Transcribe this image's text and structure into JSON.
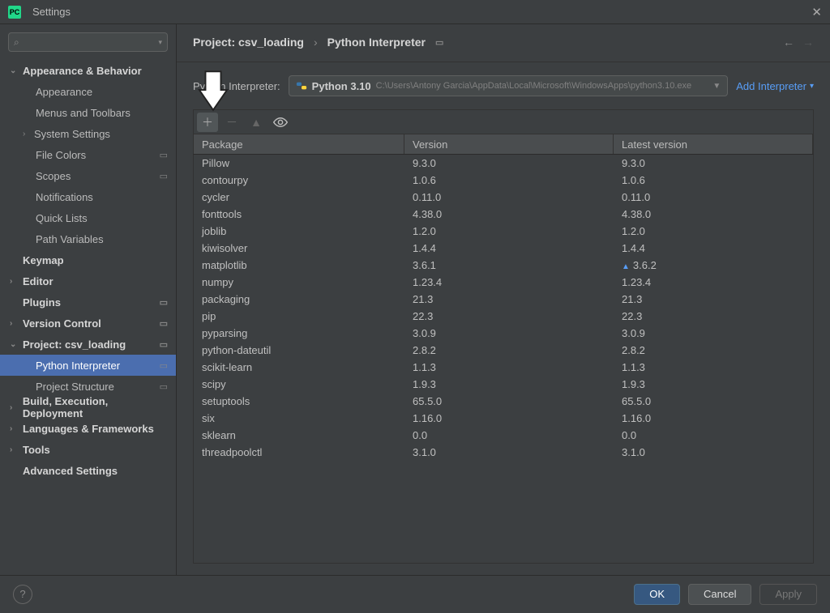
{
  "window": {
    "title": "Settings"
  },
  "search": {
    "placeholder": ""
  },
  "sidebar": {
    "items": [
      {
        "label": "Appearance & Behavior",
        "type": "expandable",
        "open": true
      },
      {
        "label": "Appearance",
        "type": "leaf"
      },
      {
        "label": "Menus and Toolbars",
        "type": "leaf"
      },
      {
        "label": "System Settings",
        "type": "leaf",
        "chevron": true
      },
      {
        "label": "File Colors",
        "type": "leaf",
        "gear": true
      },
      {
        "label": "Scopes",
        "type": "leaf",
        "gear": true
      },
      {
        "label": "Notifications",
        "type": "leaf"
      },
      {
        "label": "Quick Lists",
        "type": "leaf"
      },
      {
        "label": "Path Variables",
        "type": "leaf"
      },
      {
        "label": "Keymap",
        "type": "plain"
      },
      {
        "label": "Editor",
        "type": "expandable",
        "open": false
      },
      {
        "label": "Plugins",
        "type": "plain",
        "gear": true
      },
      {
        "label": "Version Control",
        "type": "expandable",
        "open": false,
        "gear": true
      },
      {
        "label": "Project: csv_loading",
        "type": "expandable",
        "open": true,
        "gear": true
      },
      {
        "label": "Python Interpreter",
        "type": "leaf",
        "gear": true,
        "selected": true
      },
      {
        "label": "Project Structure",
        "type": "leaf",
        "gear": true
      },
      {
        "label": "Build, Execution, Deployment",
        "type": "expandable",
        "open": false
      },
      {
        "label": "Languages & Frameworks",
        "type": "expandable",
        "open": false
      },
      {
        "label": "Tools",
        "type": "expandable",
        "open": false
      },
      {
        "label": "Advanced Settings",
        "type": "plain"
      }
    ]
  },
  "breadcrumb": {
    "part1": "Project: csv_loading",
    "part2": "Python Interpreter"
  },
  "interpreter": {
    "label": "Python Interpreter:",
    "name": "Python 3.10",
    "path": "C:\\Users\\Antony Garcia\\AppData\\Local\\Microsoft\\WindowsApps\\python3.10.exe",
    "add_label": "Add Interpreter"
  },
  "packages": {
    "columns": {
      "package": "Package",
      "version": "Version",
      "latest": "Latest version"
    },
    "rows": [
      {
        "name": "Pillow",
        "version": "9.3.0",
        "latest": "9.3.0"
      },
      {
        "name": "contourpy",
        "version": "1.0.6",
        "latest": "1.0.6"
      },
      {
        "name": "cycler",
        "version": "0.11.0",
        "latest": "0.11.0"
      },
      {
        "name": "fonttools",
        "version": "4.38.0",
        "latest": "4.38.0"
      },
      {
        "name": "joblib",
        "version": "1.2.0",
        "latest": "1.2.0"
      },
      {
        "name": "kiwisolver",
        "version": "1.4.4",
        "latest": "1.4.4"
      },
      {
        "name": "matplotlib",
        "version": "3.6.1",
        "latest": "3.6.2",
        "upgrade": true
      },
      {
        "name": "numpy",
        "version": "1.23.4",
        "latest": "1.23.4"
      },
      {
        "name": "packaging",
        "version": "21.3",
        "latest": "21.3"
      },
      {
        "name": "pip",
        "version": "22.3",
        "latest": "22.3"
      },
      {
        "name": "pyparsing",
        "version": "3.0.9",
        "latest": "3.0.9"
      },
      {
        "name": "python-dateutil",
        "version": "2.8.2",
        "latest": "2.8.2"
      },
      {
        "name": "scikit-learn",
        "version": "1.1.3",
        "latest": "1.1.3"
      },
      {
        "name": "scipy",
        "version": "1.9.3",
        "latest": "1.9.3"
      },
      {
        "name": "setuptools",
        "version": "65.5.0",
        "latest": "65.5.0"
      },
      {
        "name": "six",
        "version": "1.16.0",
        "latest": "1.16.0"
      },
      {
        "name": "sklearn",
        "version": "0.0",
        "latest": "0.0"
      },
      {
        "name": "threadpoolctl",
        "version": "3.1.0",
        "latest": "3.1.0"
      }
    ]
  },
  "footer": {
    "ok": "OK",
    "cancel": "Cancel",
    "apply": "Apply"
  }
}
